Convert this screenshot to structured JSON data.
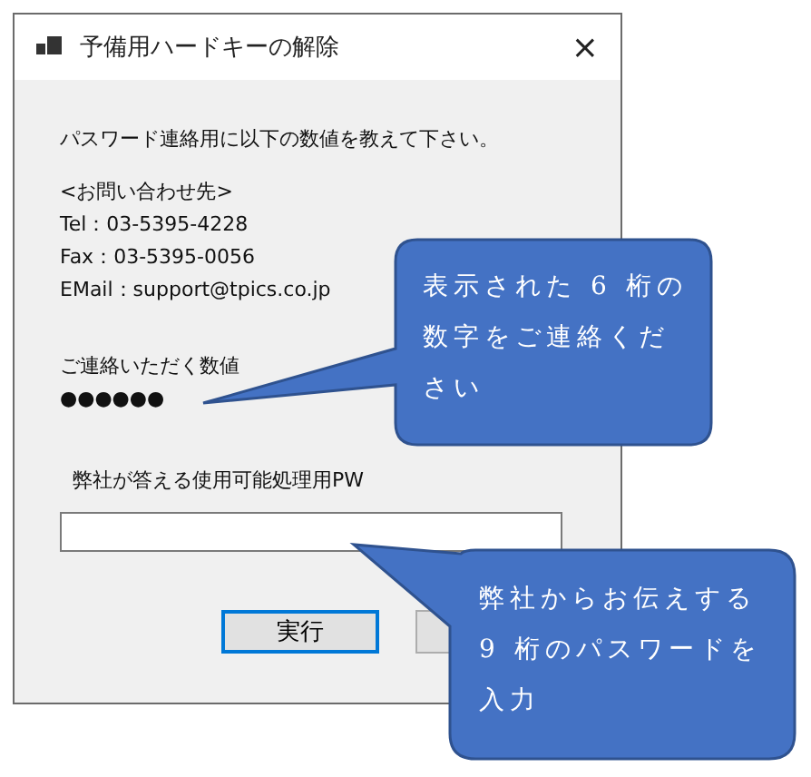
{
  "window": {
    "title": "予備用ハードキーの解除",
    "close": "×"
  },
  "message": "パスワード連絡用に以下の数値を教えて下さい。",
  "contact": {
    "heading": "<お問い合わせ先>",
    "lines": [
      "Tel：03-5395-4228",
      "Fax：03-5395-0056",
      "EMail：support@tpics.co.jp"
    ]
  },
  "code": {
    "label": "ご連絡いただく数値",
    "value": "●●●●●●"
  },
  "password": {
    "label": "弊社が答える使用可能処理用PW"
  },
  "buttons": [
    {
      "label": "実行",
      "focused": true
    },
    {
      "focused": false
    }
  ],
  "callouts": [
    {
      "text": "表示された 6 桁の数字をご連絡ください"
    },
    {
      "text": "弊社からお伝えする 9 桁のパスワードを入力"
    }
  ]
}
